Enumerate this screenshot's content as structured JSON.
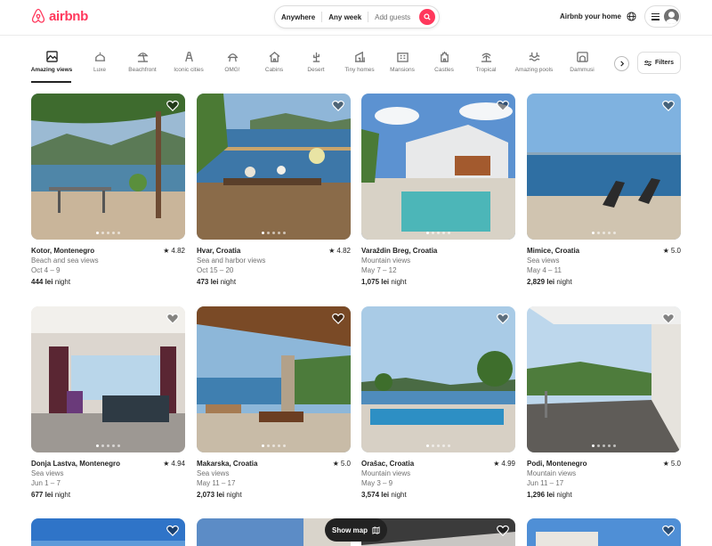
{
  "brand": {
    "name": "airbnb",
    "color": "#ff385c"
  },
  "search": {
    "where": "Anywhere",
    "when": "Any week",
    "guests": "Add guests"
  },
  "header": {
    "host_link": "Airbnb your home"
  },
  "categories": [
    {
      "label": "Amazing views",
      "icon": "mountain-view-icon",
      "active": true
    },
    {
      "label": "Luxe",
      "icon": "luxe-icon"
    },
    {
      "label": "Beachfront",
      "icon": "beach-umbrella-icon"
    },
    {
      "label": "Iconic cities",
      "icon": "city-icon"
    },
    {
      "label": "OMG!",
      "icon": "ufo-house-icon"
    },
    {
      "label": "Cabins",
      "icon": "cabin-icon"
    },
    {
      "label": "Desert",
      "icon": "cactus-icon"
    },
    {
      "label": "Tiny homes",
      "icon": "tiny-home-icon"
    },
    {
      "label": "Mansions",
      "icon": "mansion-icon"
    },
    {
      "label": "Castles",
      "icon": "castle-icon"
    },
    {
      "label": "Tropical",
      "icon": "palm-tree-icon"
    },
    {
      "label": "Amazing pools",
      "icon": "pool-icon"
    },
    {
      "label": "Dammusi",
      "icon": "dammuso-icon"
    }
  ],
  "filters_label": "Filters",
  "listings": [
    {
      "location": "Kotor, Montenegro",
      "rating": "4.82",
      "view": "Beach and sea views",
      "dates": "Oct 4 – 9",
      "price": "444 lei",
      "price_unit": "night"
    },
    {
      "location": "Hvar, Croatia",
      "rating": "4.82",
      "view": "Sea and harbor views",
      "dates": "Oct 15 – 20",
      "price": "473 lei",
      "price_unit": "night"
    },
    {
      "location": "Varaždin Breg, Croatia",
      "rating": "",
      "view": "Mountain views",
      "dates": "May 7 – 12",
      "price": "1,075 lei",
      "price_unit": "night"
    },
    {
      "location": "Mimice, Croatia",
      "rating": "5.0",
      "view": "Sea views",
      "dates": "May 4 – 11",
      "price": "2,829 lei",
      "price_unit": "night"
    },
    {
      "location": "Donja Lastva, Montenegro",
      "rating": "4.94",
      "view": "Sea views",
      "dates": "Jun 1 – 7",
      "price": "677 lei",
      "price_unit": "night"
    },
    {
      "location": "Makarska, Croatia",
      "rating": "5.0",
      "view": "Sea views",
      "dates": "May 11 – 17",
      "price": "2,073 lei",
      "price_unit": "night"
    },
    {
      "location": "Orašac, Croatia",
      "rating": "4.99",
      "view": "Mountain views",
      "dates": "May 3 – 9",
      "price": "3,574 lei",
      "price_unit": "night"
    },
    {
      "location": "Podi, Montenegro",
      "rating": "5.0",
      "view": "Mountain views",
      "dates": "Jun 11 – 17",
      "price": "1,296 lei",
      "price_unit": "night"
    }
  ],
  "show_map_label": "Show map"
}
